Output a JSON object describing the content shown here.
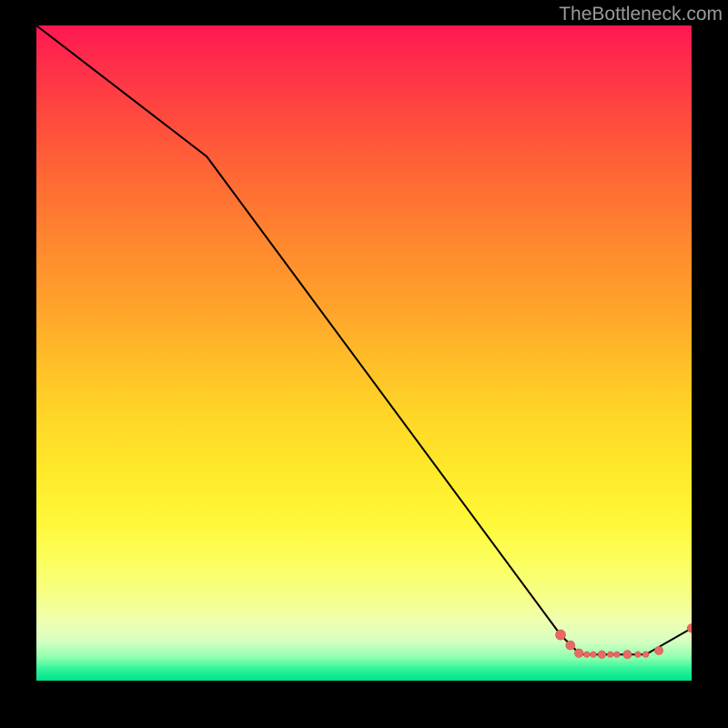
{
  "watermark": "TheBottleneck.com",
  "colors": {
    "line": "#000000",
    "marker": "#e86a63",
    "marker_stroke": "#d2564f"
  },
  "chart_data": {
    "type": "line",
    "title": "",
    "xlabel": "",
    "ylabel": "",
    "xlim": [
      0,
      100
    ],
    "ylim": [
      0,
      100
    ],
    "grid": false,
    "legend": false,
    "series": [
      {
        "name": "curve",
        "x": [
          0,
          26,
          80,
          83,
          93,
          100
        ],
        "y": [
          100,
          80,
          7,
          4,
          4,
          8
        ]
      }
    ],
    "markers": [
      {
        "x": 80.0,
        "y": 7.0,
        "r": 5.5
      },
      {
        "x": 81.5,
        "y": 5.4,
        "r": 5.0
      },
      {
        "x": 82.8,
        "y": 4.2,
        "r": 4.8
      },
      {
        "x": 84.0,
        "y": 4.0,
        "r": 3.3
      },
      {
        "x": 85.0,
        "y": 4.0,
        "r": 3.3
      },
      {
        "x": 86.3,
        "y": 4.0,
        "r": 4.3
      },
      {
        "x": 87.6,
        "y": 4.0,
        "r": 3.3
      },
      {
        "x": 88.6,
        "y": 4.0,
        "r": 3.3
      },
      {
        "x": 90.2,
        "y": 4.0,
        "r": 4.6
      },
      {
        "x": 91.8,
        "y": 4.0,
        "r": 3.3
      },
      {
        "x": 93.0,
        "y": 4.0,
        "r": 3.3
      },
      {
        "x": 95.0,
        "y": 4.6,
        "r": 4.6
      },
      {
        "x": 100.0,
        "y": 8.0,
        "r": 4.8
      }
    ]
  }
}
